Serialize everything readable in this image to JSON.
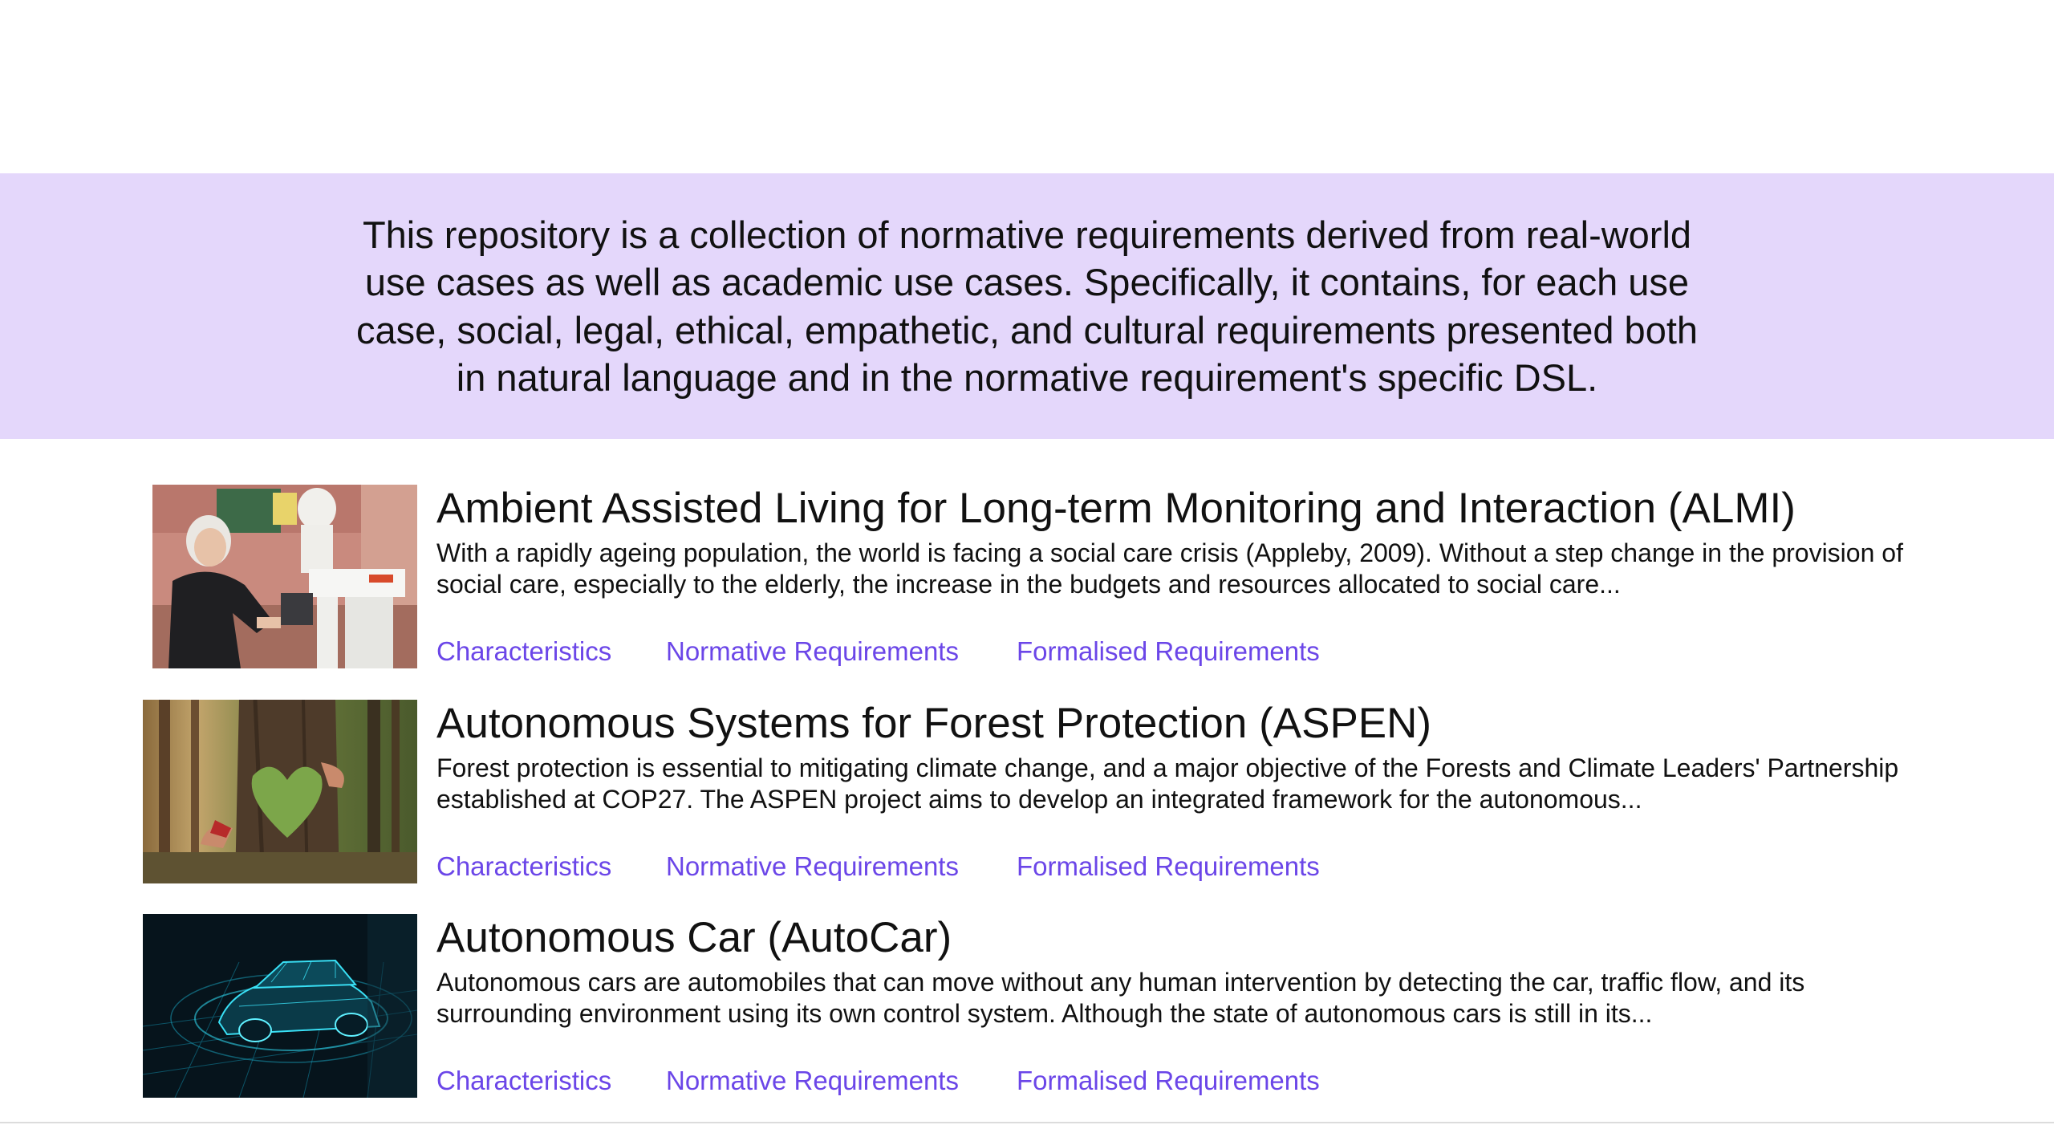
{
  "intro": {
    "text": "This repository is a collection of normative requirements derived from real-world use cases as well as academic use cases. Specifically, it contains, for each use case, social, legal, ethical, empathetic, and cultural requirements presented both in natural language and in the normative requirement's specific DSL."
  },
  "colors": {
    "banner_bg": "#e4d7fb",
    "link": "#6b46e8",
    "text": "#111111"
  },
  "cases": [
    {
      "title": "Ambient Assisted Living for Long-term Monitoring and Interaction (ALMI)",
      "description": "With a rapidly ageing population, the world is facing a social care crisis (Appleby, 2009). Without a step change in the provision of social care, especially to the elderly, the increase in the budgets and resources allocated to social care...",
      "image": "elderly-woman-with-assistive-robot-photo",
      "links": {
        "characteristics": "Characteristics",
        "normative": "Normative Requirements",
        "formalised": "Formalised Requirements"
      }
    },
    {
      "title": "Autonomous Systems for Forest Protection (ASPEN)",
      "description": "Forest protection is essential to mitigating climate change, and a major objective of the Forests and Climate Leaders' Partnership established at COP27. The ASPEN project aims to develop an integrated framework for the autonomous...",
      "image": "hands-hugging-tree-with-moss-heart-photo",
      "links": {
        "characteristics": "Characteristics",
        "normative": "Normative Requirements",
        "formalised": "Formalised Requirements"
      }
    },
    {
      "title": "Autonomous Car (AutoCar)",
      "description": "Autonomous cars are automobiles that can move without any human intervention by detecting the car, traffic flow, and its surrounding environment using its own control system. Although the state of autonomous cars is still in its...",
      "image": "wireframe-car-digital-illustration",
      "links": {
        "characteristics": "Characteristics",
        "normative": "Normative Requirements",
        "formalised": "Formalised Requirements"
      }
    }
  ]
}
